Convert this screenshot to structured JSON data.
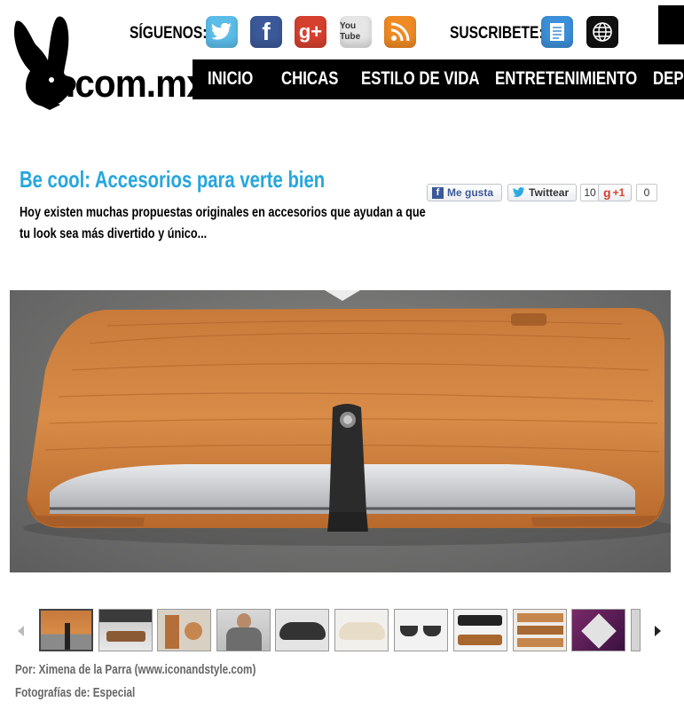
{
  "header": {
    "logo_text": ".com.mx",
    "follow_label": "SÍGUENOS:",
    "subscribe_label": "SUSCRIBETE:",
    "social_icons": [
      "twitter-icon",
      "facebook-icon",
      "google-plus-icon",
      "youtube-icon",
      "rss-icon"
    ],
    "subscribe_icons": [
      "document-icon",
      "globe-icon"
    ],
    "youtube_label": "You Tube"
  },
  "nav": {
    "items": [
      "INICIO",
      "CHICAS",
      "ESTILO DE VIDA",
      "ENTRETENIMIENTO",
      "DEPO"
    ]
  },
  "article": {
    "title": "Be cool: Accesorios para verte bien",
    "summary": "Hoy existen muchas propuestas originales en accesorios que ayudan a que tu look sea más divertido y único...",
    "credit_author": "Por: Ximena de la Parra (www.iconandstyle.com)",
    "credit_photos": "Fotografías de: Especial"
  },
  "share": {
    "like_label": "Me gusta",
    "tweet_label": "Twittear",
    "tweet_count": "10",
    "gplus_label": "+1",
    "gplus_count": "0"
  },
  "gallery": {
    "prev_icon": "left-arrow-icon",
    "next_icon": "right-arrow-icon",
    "thumbnail_count": 11
  },
  "colors": {
    "title": "#26a6dd",
    "nav_bg": "#000000",
    "twitter": "#5cbde9",
    "facebook": "#3b5998",
    "google": "#d6402f",
    "youtube": "#d7d7d7",
    "rss": "#f08a24",
    "subscribe_doc": "#3c8fd8"
  }
}
